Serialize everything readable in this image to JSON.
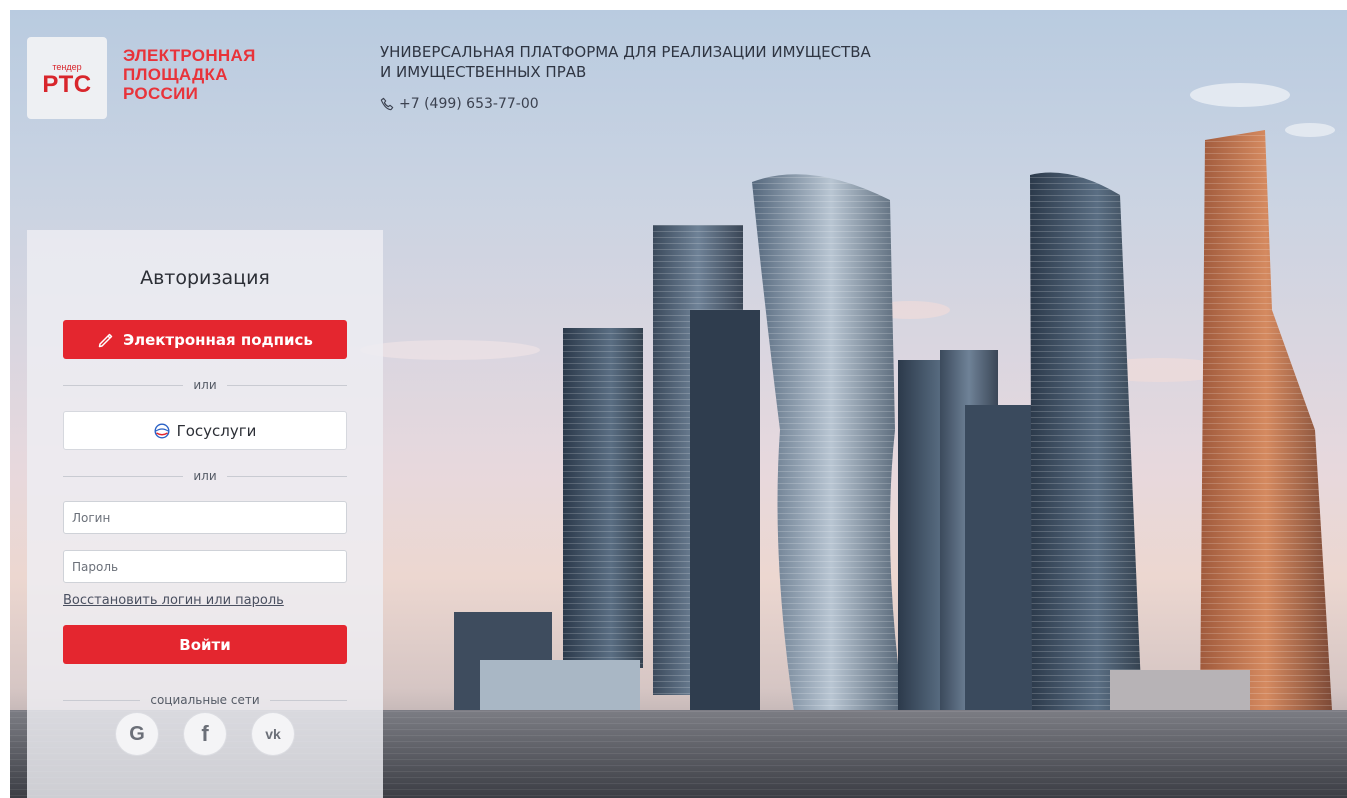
{
  "brand": {
    "small_label": "тендер",
    "logo_letters": "РТС",
    "name_lines": [
      "ЭЛЕКТРОННАЯ",
      "ПЛОЩАДКА",
      "РОССИИ"
    ],
    "accent_color": "#e4262f"
  },
  "header": {
    "platform_lines": [
      "УНИВЕРСАЛЬНАЯ ПЛАТФОРМА ДЛЯ РЕАЛИЗАЦИИ ИМУЩЕСТВА",
      "И ИМУЩЕСТВЕННЫХ ПРАВ"
    ],
    "phone": "+7 (499) 653-77-00",
    "phone_icon": "phone-icon"
  },
  "auth": {
    "title": "Авторизация",
    "esign_button": "Электронная подпись",
    "esign_icon": "signature-pen-icon",
    "or_label": "или",
    "gosuslugi_button": "Госуслуги",
    "gosuslugi_icon": "gosuslugi-logo-icon",
    "login_placeholder": "Логин",
    "password_placeholder": "Пароль",
    "recover_link": "Восстановить логин или пароль",
    "submit_button": "Войти",
    "social_label": "социальные сети",
    "social": [
      {
        "name": "google",
        "glyph": "G"
      },
      {
        "name": "facebook",
        "glyph": "f"
      },
      {
        "name": "vk",
        "glyph": "vk"
      }
    ]
  }
}
